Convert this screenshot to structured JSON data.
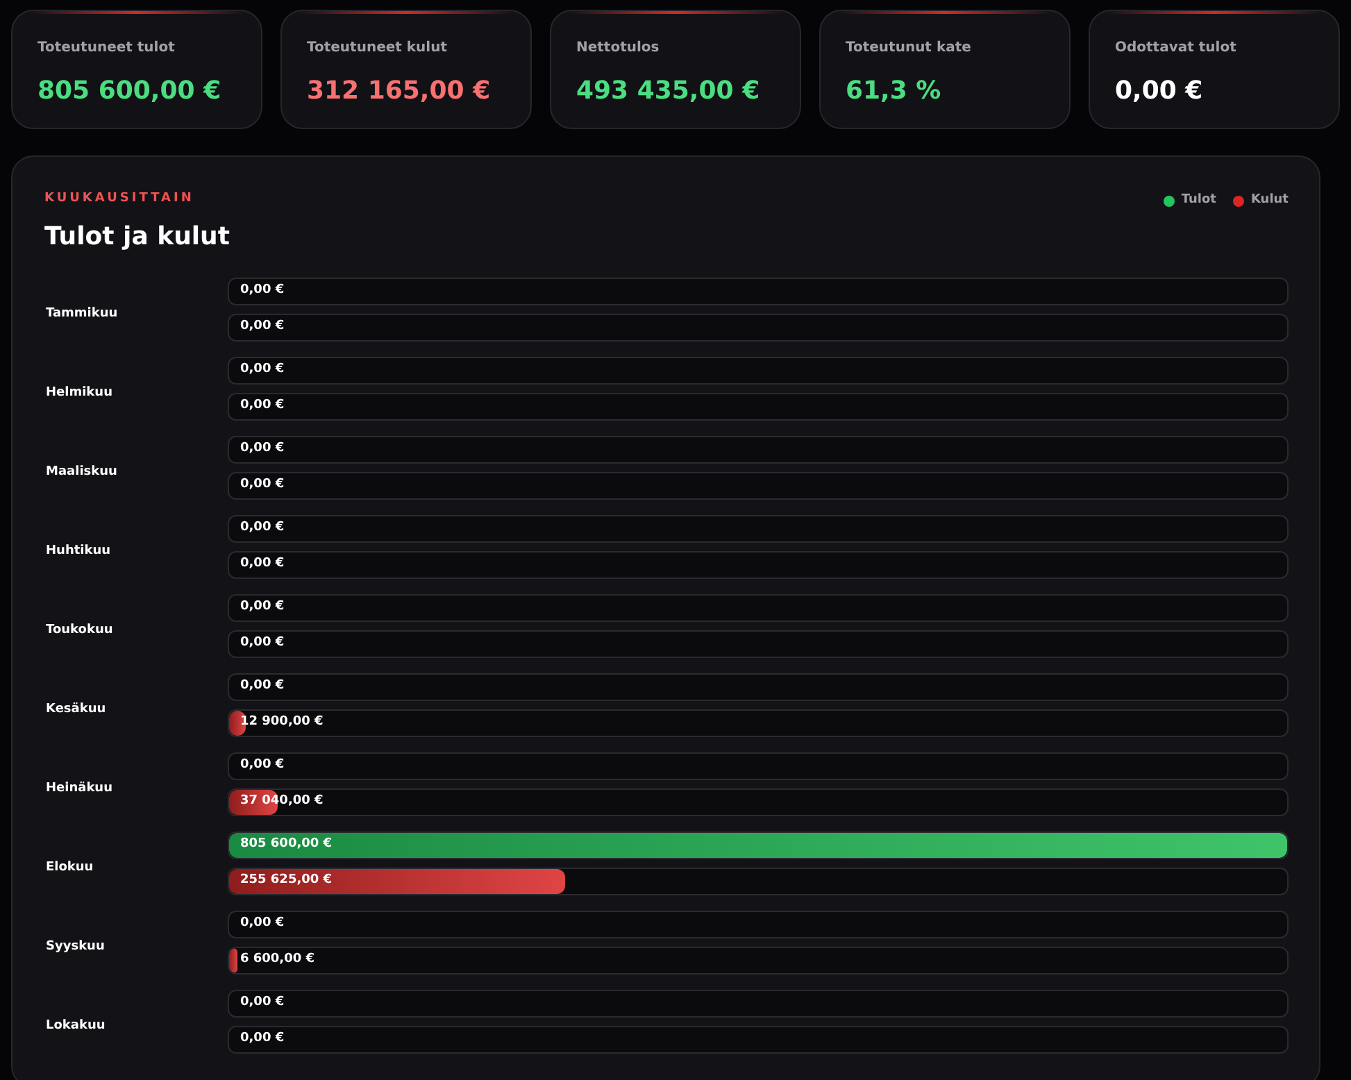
{
  "summary_cards": [
    {
      "label": "Toteutuneet tulot",
      "value": "805 600,00 €",
      "kind": "positive"
    },
    {
      "label": "Toteutuneet kulut",
      "value": "312 165,00 €",
      "kind": "negative"
    },
    {
      "label": "Nettotulos",
      "value": "493 435,00 €",
      "kind": "positive"
    },
    {
      "label": "Toteutunut kate",
      "value": "61,3 %",
      "kind": "positive"
    },
    {
      "label": "Odottavat tulot",
      "value": "0,00 €",
      "kind": "neutral"
    }
  ],
  "panel": {
    "eyebrow": "KUUKAUSITTAIN",
    "title": "Tulot ja kulut",
    "legend": [
      {
        "label": "Tulot",
        "color": "#22c55e"
      },
      {
        "label": "Kulut",
        "color": "#dc2626"
      }
    ],
    "months": [
      {
        "month": "Tammikuu",
        "income": {
          "value": "0,00 €"
        },
        "expense": {
          "value": "0,00 €"
        }
      },
      {
        "month": "Helmikuu",
        "income": {
          "value": "0,00 €"
        },
        "expense": {
          "value": "0,00 €"
        }
      },
      {
        "month": "Maaliskuu",
        "income": {
          "value": "0,00 €"
        },
        "expense": {
          "value": "0,00 €"
        }
      },
      {
        "month": "Huhtikuu",
        "income": {
          "value": "0,00 €"
        },
        "expense": {
          "value": "0,00 €"
        }
      },
      {
        "month": "Toukokuu",
        "income": {
          "value": "0,00 €"
        },
        "expense": {
          "value": "0,00 €"
        }
      },
      {
        "month": "Kesäkuu",
        "income": {
          "value": "0,00 €"
        },
        "expense": {
          "value": "12 900,00 €",
          "level": 0.016
        }
      },
      {
        "month": "Heinäkuu",
        "income": {
          "value": "0,00 €"
        },
        "expense": {
          "value": "37 040,00 €",
          "level": 0.046
        }
      },
      {
        "month": "Elokuu",
        "income": {
          "value": "805 600,00 €",
          "level": 1
        },
        "expense": {
          "value": "255 625,00 €",
          "level": 0.317
        }
      },
      {
        "month": "Syyskuu",
        "income": {
          "value": "0,00 €"
        },
        "expense": {
          "value": "6 600,00 €",
          "level": 0.008
        }
      },
      {
        "month": "Lokakuu",
        "income": {
          "value": "0,00 €"
        },
        "expense": {
          "value": "0,00 €"
        }
      }
    ]
  }
}
